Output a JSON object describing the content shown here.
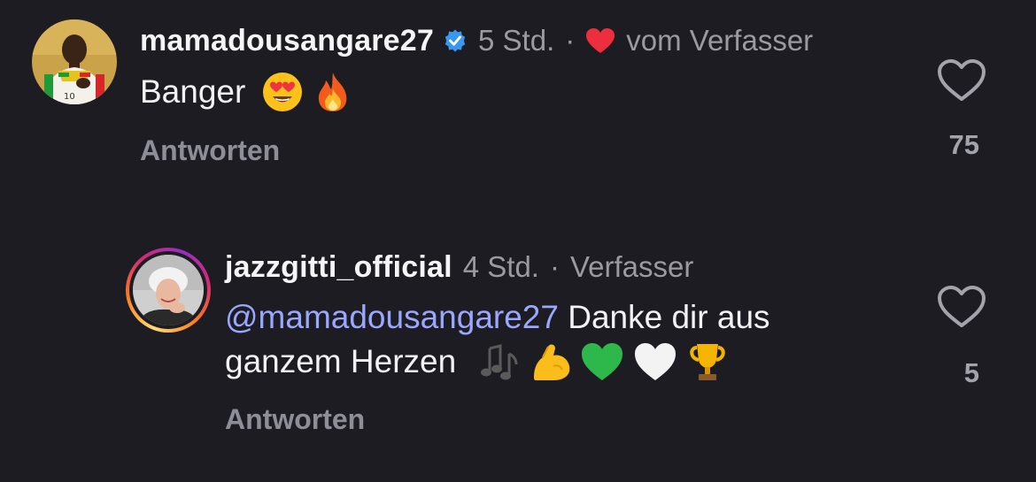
{
  "comments": [
    {
      "username": "mamadousangare27",
      "verified": true,
      "time": "5 Std.",
      "separator": "·",
      "author_like": "vom Verfasser",
      "text": "Banger",
      "emojis": [
        "smiling-face-heart-eyes",
        "fire"
      ],
      "reply_label": "Antworten",
      "likes": "75"
    },
    {
      "username": "jazzgitti_official",
      "time": "4 Std.",
      "separator": "·",
      "badge": "Verfasser",
      "mention": "@mamadousangare27",
      "text_line1": " Danke dir aus",
      "text_line2": "ganzem Herzen ",
      "emojis": [
        "musical-notes",
        "flexed-biceps",
        "green-heart",
        "white-heart",
        "trophy"
      ],
      "reply_label": "Antworten",
      "likes": "5"
    }
  ],
  "colors": {
    "background": "#1d1c22",
    "text": "#f5f5f7",
    "secondary": "#9a9aa3",
    "mention": "#9aa7ff",
    "verified": "#3897f0",
    "heart": "#ed2e3e"
  }
}
